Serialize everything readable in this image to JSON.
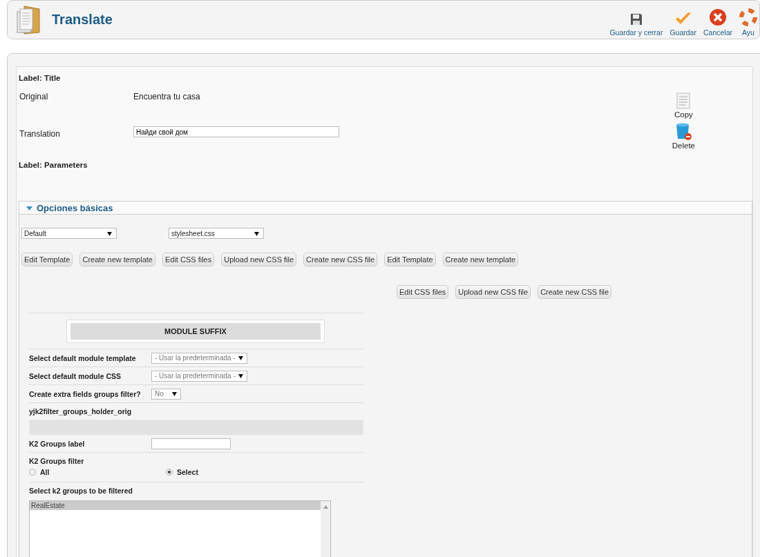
{
  "header": {
    "title": "Translate"
  },
  "toolbar": [
    {
      "kind": "save-close",
      "label": "Guardar y cerrar"
    },
    {
      "kind": "save",
      "label": "Guardar"
    },
    {
      "kind": "cancel",
      "label": "Cancelar"
    },
    {
      "kind": "help",
      "label": "Ayu"
    }
  ],
  "title_section": {
    "heading": "Label: Title",
    "original_label": "Original",
    "original_value": "Encuentra tu casa",
    "translation_label": "Translation",
    "translation_value": "Найди свой дом"
  },
  "actions": [
    {
      "kind": "copy",
      "label": "Copy"
    },
    {
      "kind": "delete",
      "label": "Delete"
    }
  ],
  "parameters_heading": "Label: Parameters",
  "section": {
    "title": "Opciones básicas",
    "expanded": true,
    "selects": [
      "Default",
      "stylesheet.css"
    ],
    "buttons_row_1": [
      "Edit Template",
      "Create new template",
      "Edit CSS files",
      "Upload new CSS file",
      "Create new CSS file",
      "Edit Template",
      "Create new template"
    ],
    "buttons_row_2": [
      "Edit CSS files",
      "Upload new CSS file",
      "Create new CSS file"
    ],
    "module_suffix": "MODULE SUFFIX",
    "fields": [
      {
        "kind": "select",
        "label": "Select default module template",
        "value": "- Usar la predeterminada -"
      },
      {
        "kind": "select",
        "label": "Select default module CSS",
        "value": "- Usar la predeterminada -"
      },
      {
        "kind": "small-select",
        "label": "Create extra fields groups filter?",
        "value": "No"
      },
      {
        "kind": "bar",
        "label": "yjk2filter_groups_holder_orig"
      },
      {
        "kind": "text",
        "label": "K2 Groups label"
      },
      {
        "kind": "radio",
        "label": "K2 Groups filter",
        "options": [
          {
            "label": "All",
            "selected": false
          },
          {
            "label": "Select",
            "selected": true
          }
        ]
      },
      {
        "kind": "list",
        "label": "Select k2 groups to be filtered",
        "items": [
          {
            "label": "RealEstate",
            "selected": true
          }
        ]
      }
    ]
  }
}
